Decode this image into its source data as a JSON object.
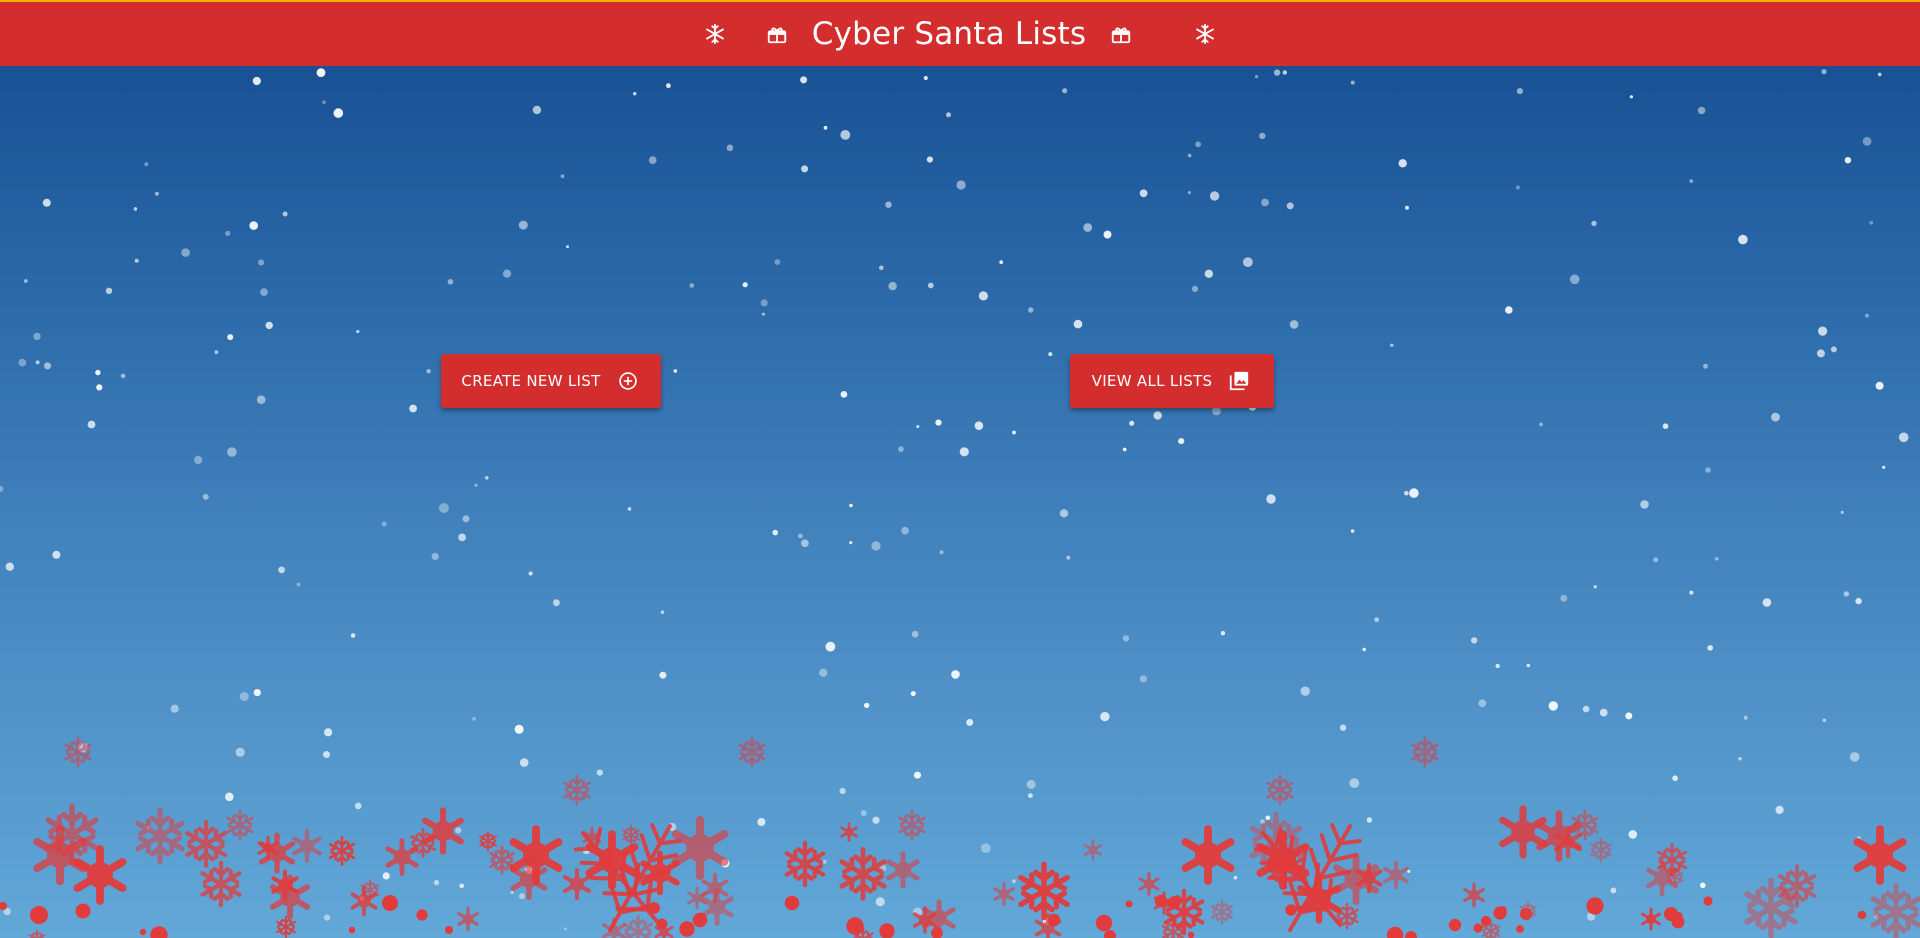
{
  "header": {
    "title": "Cyber Santa Lists",
    "icons": [
      "snowflake-icon",
      "gift-icon",
      "gift-icon",
      "snowflake-icon"
    ],
    "background": "#d42d2d",
    "top_border": "#e8b400"
  },
  "actions": {
    "create_label": "CREATE NEW LIST",
    "create_icon": "add-circle-icon",
    "view_label": "VIEW ALL LISTS",
    "view_icon": "photo-library-icon"
  },
  "theme": {
    "sky_top": "#134b8e",
    "sky_bottom": "#62a8d8",
    "snow": "#ffffff",
    "flake_red": "#e23b3b"
  }
}
